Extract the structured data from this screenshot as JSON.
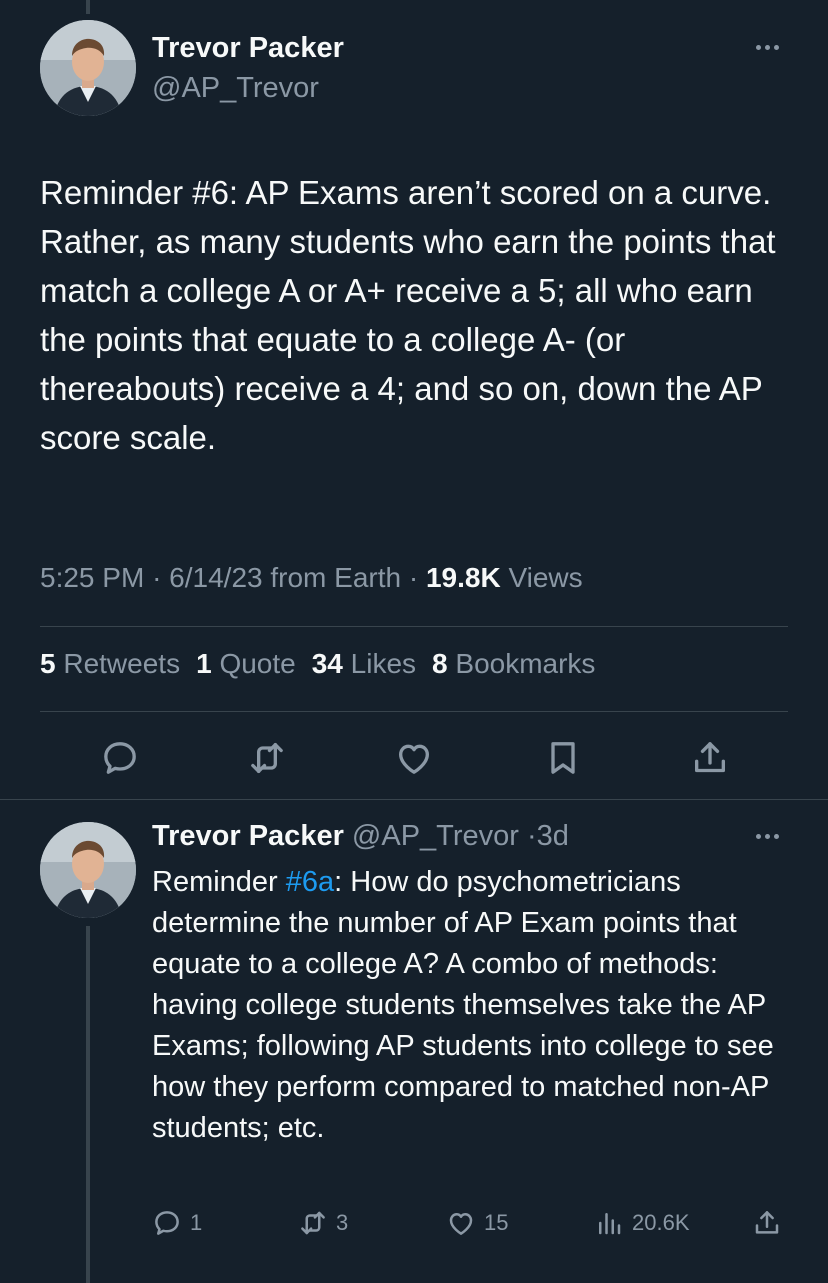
{
  "main_tweet": {
    "author_name": "Trevor Packer",
    "author_handle": "@AP_Trevor",
    "text": "Reminder #6: AP Exams aren’t scored on a curve. Rather, as many students who earn the points that match a college A or A+ receive a 5; all who earn the points that equate to a college A- (or thereabouts) receive a 4; and so on, down the AP score scale.",
    "time": "5:25 PM",
    "date": "6/14/23",
    "source": "from Earth",
    "views_count": "19.8K",
    "views_label": "Views",
    "stats": [
      {
        "count": "5",
        "label": "Retweets"
      },
      {
        "count": "1",
        "label": "Quote"
      },
      {
        "count": "34",
        "label": "Likes"
      },
      {
        "count": "8",
        "label": "Bookmarks"
      }
    ],
    "actions": [
      "reply-icon",
      "retweet-icon",
      "like-icon",
      "bookmark-icon",
      "share-icon"
    ]
  },
  "reply_tweet": {
    "author_name": "Trevor Packer",
    "author_handle": "@AP_Trevor",
    "age": "3d",
    "text_before": "Reminder ",
    "hashtag": "#6a",
    "text_after": ": How do psychometricians determine the number of AP Exam points that equate to a college A? A combo of methods: having college students themselves take the AP Exams; following AP students into college to see how they perform compared to matched non-AP students; etc.",
    "reply_count": "1",
    "retweet_count": "3",
    "like_count": "15",
    "view_count": "20.6K"
  },
  "colors": {
    "background": "#15202b",
    "text_primary": "#f7f9f9",
    "text_secondary": "#8b98a5",
    "link": "#1d9bf0",
    "divider": "#38444d"
  }
}
